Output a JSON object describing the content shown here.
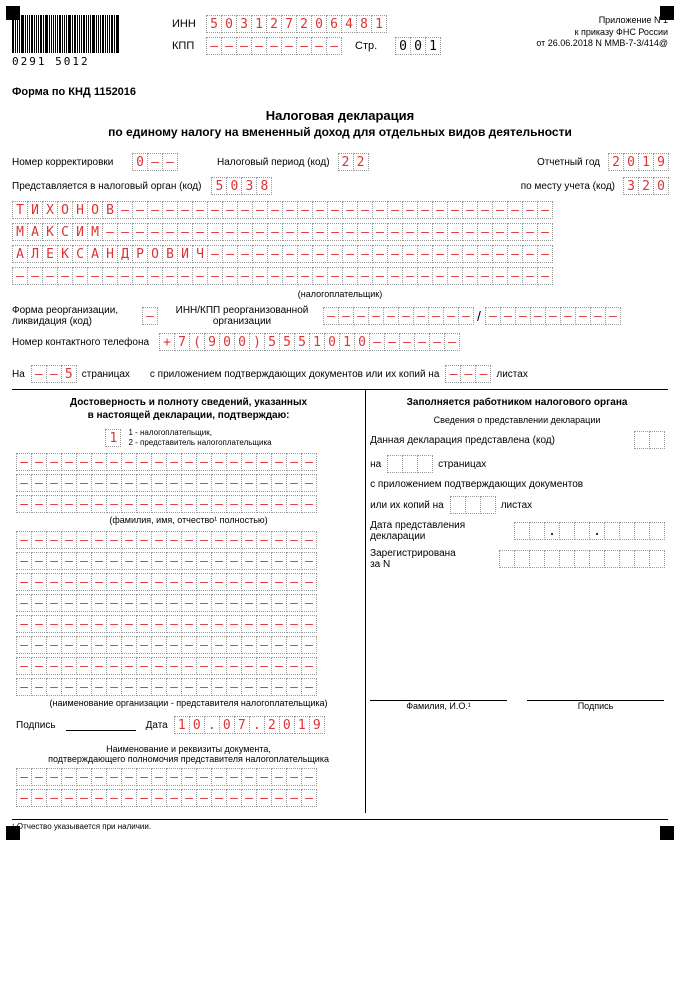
{
  "appendix": {
    "l1": "Приложение N 1",
    "l2": "к приказу ФНС России",
    "l3": "от 26.06.2018 N ММВ-7-3/414@"
  },
  "barcode_num": "0291 5012",
  "inn_label": "ИНН",
  "kpp_label": "КПП",
  "page_label": "Стр.",
  "inn": [
    "5",
    "0",
    "3",
    "1",
    "2",
    "7",
    "2",
    "0",
    "6",
    "4",
    "8",
    "1"
  ],
  "kpp": [
    "–",
    "–",
    "–",
    "–",
    "–",
    "–",
    "–",
    "–",
    "–"
  ],
  "page": [
    "0",
    "0",
    "1"
  ],
  "form_code": "Форма по КНД 1152016",
  "title": "Налоговая декларация",
  "subtitle": "по единому налогу на вмененный доход для отдельных видов деятельности",
  "corr_lbl": "Номер корректировки",
  "corr": [
    "0",
    "–",
    "–"
  ],
  "period_lbl": "Налоговый период (код)",
  "period": [
    "2",
    "2"
  ],
  "year_lbl": "Отчетный год",
  "year": [
    "2",
    "0",
    "1",
    "9"
  ],
  "organ_lbl": "Представляется в налоговый орган (код)",
  "organ": [
    "5",
    "0",
    "3",
    "8"
  ],
  "place_lbl": "по месту учета (код)",
  "place": [
    "3",
    "2",
    "0"
  ],
  "fio": {
    "r1": [
      "Т",
      "И",
      "Х",
      "О",
      "Н",
      "О",
      "В"
    ],
    "r2": [
      "М",
      "А",
      "К",
      "С",
      "И",
      "М"
    ],
    "r3": [
      "А",
      "Л",
      "Е",
      "К",
      "С",
      "А",
      "Н",
      "Д",
      "Р",
      "О",
      "В",
      "И",
      "Ч"
    ]
  },
  "fio_width": 36,
  "taxpayer_lbl": "(налогоплательщик)",
  "reorg_lbl1": "Форма реорганизации,",
  "reorg_lbl2": "ликвидация (код)",
  "reorg_inn_lbl1": "ИНН/КПП реорганизованной",
  "reorg_inn_lbl2": "организации",
  "phone_lbl": "Номер контактного телефона",
  "phone": [
    "+",
    "7",
    "(",
    "9",
    "0",
    "0",
    ")",
    "5",
    "5",
    "5",
    "1",
    "0",
    "1",
    "0",
    "–",
    "–",
    "–",
    "–",
    "–",
    "–"
  ],
  "pages_lbl1": "На",
  "pages_val": [
    "–",
    "–",
    "5"
  ],
  "pages_lbl2": "страницах",
  "pages_lbl3": "с приложением подтверждающих документов или их копий на",
  "pages_lbl4": "листах",
  "left": {
    "title1": "Достоверность и полноту сведений, указанных",
    "title2": "в настоящей декларации, подтверждаю:",
    "who": "1",
    "who_legend1": "1 - налогоплательщик,",
    "who_legend2": "2 - представитель налогоплательщика",
    "fio_note": "(фамилия, имя, отчество¹ полностью)",
    "org_note": "(наименование организации - представителя налогоплательщика)",
    "sign_lbl": "Подпись",
    "date_lbl": "Дата",
    "date": [
      "1",
      "0",
      ".",
      "0",
      "7",
      ".",
      "2",
      "0",
      "1",
      "9"
    ],
    "doc_lbl1": "Наименование и реквизиты документа,",
    "doc_lbl2": "подтверждающего полномочия представителя налогоплательщика"
  },
  "right": {
    "title": "Заполняется работником налогового органа",
    "sub": "Сведения о представлении декларации",
    "l1a": "Данная декларация представлена (код)",
    "l2a": "на",
    "l2b": "страницах",
    "l3": "с приложением подтверждающих документов",
    "l4a": "или их копий на",
    "l4b": "листах",
    "l5a": "Дата представления",
    "l5b": "декларации",
    "l6a": "Зарегистрирована",
    "l6b": "за N",
    "sig1": "Фамилия, И.О.¹",
    "sig2": "Подпись"
  },
  "footnote": "¹ Отчество указывается при наличии."
}
